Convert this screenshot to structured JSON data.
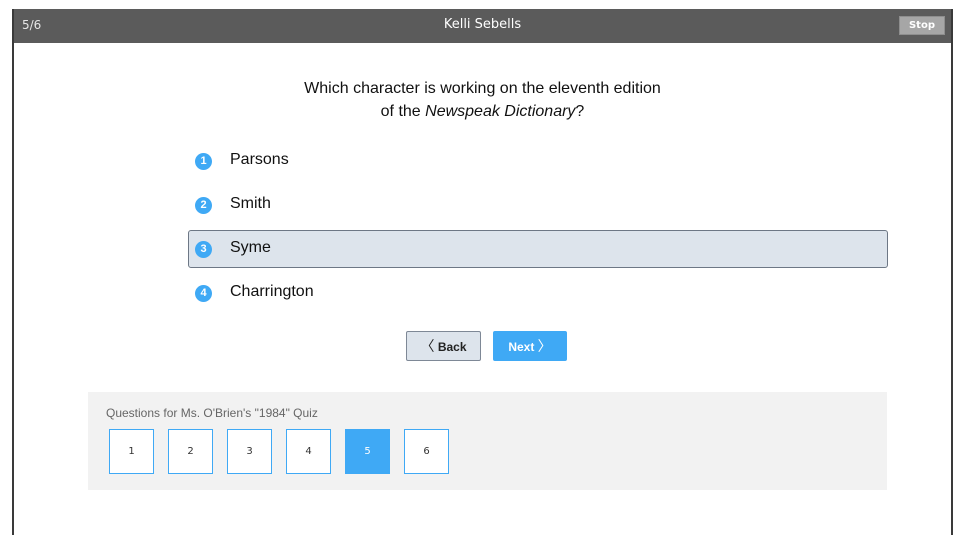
{
  "header": {
    "progress": "5/6",
    "student_name": "Kelli Sebells",
    "stop_label": "Stop"
  },
  "question": {
    "line1": "Which character is working on the eleventh edition",
    "line2_prefix": "of the ",
    "line2_italic": "Newspeak Dictionary",
    "line2_suffix": "?"
  },
  "answers": [
    {
      "number": "1",
      "label": "Parsons",
      "selected": false
    },
    {
      "number": "2",
      "label": "Smith",
      "selected": false
    },
    {
      "number": "3",
      "label": "Syme",
      "selected": true
    },
    {
      "number": "4",
      "label": "Charrington",
      "selected": false
    }
  ],
  "nav": {
    "back_label": "Back",
    "next_label": "Next",
    "back_chevron": "〈",
    "next_chevron": "〉"
  },
  "question_panel": {
    "title": "Questions for Ms. O'Brien's \"1984\" Quiz",
    "buttons": [
      "1",
      "2",
      "3",
      "4",
      "5",
      "6"
    ],
    "current": "5"
  },
  "colors": {
    "accent": "#3fa9f5",
    "topbar": "#5b5b5b",
    "selected_bg": "#dde4ec"
  }
}
